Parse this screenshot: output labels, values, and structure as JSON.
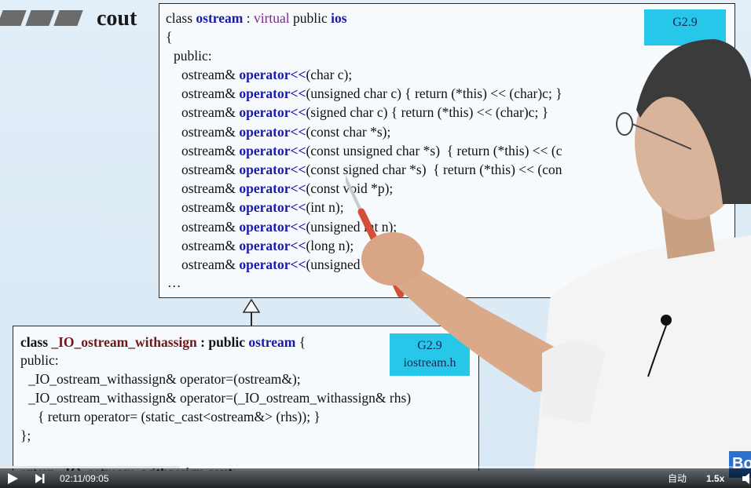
{
  "slide": {
    "title": "cout",
    "top_code": {
      "class_kw": "class ",
      "class_name": "ostream",
      "colon": " : ",
      "virtual_kw": "virtual",
      "public_base": " public ",
      "base_name": "ios",
      "open_brace": "{",
      "public_label": "public:",
      "ret": "ostream& ",
      "op": "operator<<",
      "lines": [
        "(char c);",
        "(unsigned char c) { return (*this) << (char)c; }",
        "(signed char c) { return (*this) << (char)c; }",
        "(const char *s);",
        "(const unsigned char *s)  { return (*this) << (c",
        "(const signed char *s)  { return (*this) << (con",
        "(const void *p);",
        "(int n);",
        "(unsigned int n);",
        "(long n);",
        "(unsigned long n);"
      ],
      "ellipsis": "…"
    },
    "top_badge": {
      "line1": "G2.9"
    },
    "bottom_code": {
      "class_kw": "class ",
      "class_name": "_IO_ostream_withassign",
      "inherit": " : public ",
      "base_name": "ostream",
      "open_brace": " {",
      "public_label": "public:",
      "line1": "_IO_ostream_withassign& operator=(ostream&);",
      "line2": "_IO_ostream_withassign& operator=(_IO_ostream_withassign& rhs)",
      "line3": "{ return operator= (static_cast<ostream&> (rhs)); }",
      "close": "};",
      "extern_kw": "extern ",
      "extern_type": "_IO_ostream_withassign",
      "extern_var": " cout",
      "semicolon": ";"
    },
    "bottom_badge": {
      "line1": "G2.9",
      "line2": "iostream.h"
    }
  },
  "player": {
    "current_time": "02:11",
    "separator": " / ",
    "duration": "09:05",
    "progress_fraction": 0.24,
    "auto_label": "自动",
    "speed_label": "1.5x",
    "logo_text": "Bo",
    "icons": [
      "play-icon",
      "next-icon",
      "volume-icon"
    ]
  },
  "colors": {
    "keyword_blue": "#1a1aa8",
    "virtual_purple": "#7a2a8a",
    "badge_cyan": "#27c7ea"
  }
}
